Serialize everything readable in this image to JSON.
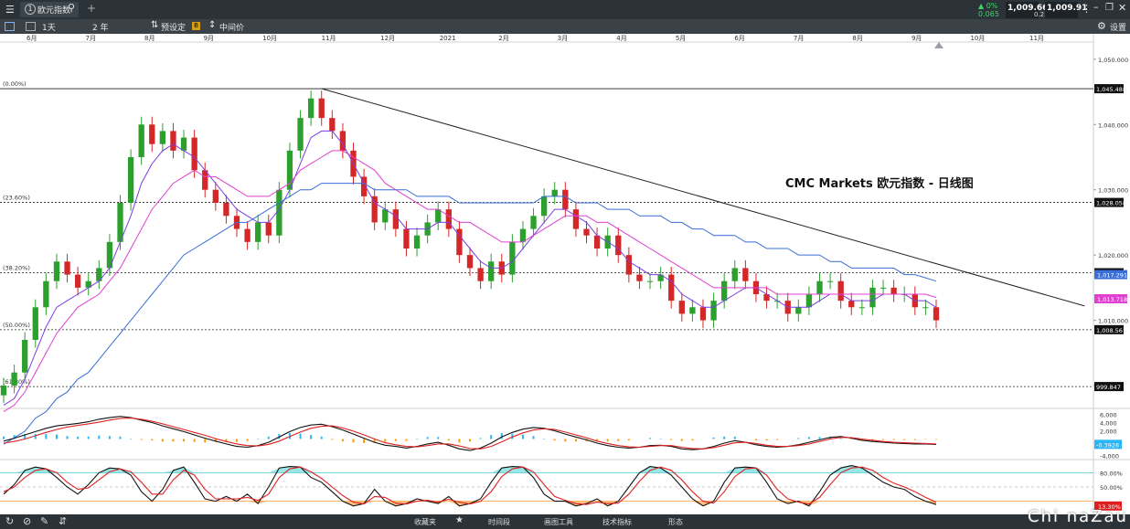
{
  "window": {
    "tab_number": "1",
    "tab_title": "欧元指数",
    "quote_change_pct": "0%",
    "quote_change_abs": "0.065",
    "bid": "1,009.66",
    "ask": "1,009.91",
    "spread": "0.25"
  },
  "toolbar": {
    "period": "1天",
    "range": "2 年",
    "preset": "预设定",
    "price_type": "中间价",
    "settings": "设置"
  },
  "chart_title": "CMC Markets 欧元指数 - 日线图",
  "bottom_bar": {
    "favorites": "收藏夹",
    "timeframe": "时间段",
    "drawing_tools": "画图工具",
    "indicators": "技术指标",
    "patterns": "形态"
  },
  "watermark": "Chi naZau",
  "colors": {
    "bull": "#2ca02c",
    "bear": "#d62728",
    "ma_fast": "#7b3fe4",
    "ma_mid": "#e040d0",
    "ma_slow": "#3a6fd8",
    "macd_pos": "#29b6f6",
    "macd_neg": "#ff9800",
    "stoch_band_high": "#7ee0e0",
    "stoch_band_low": "#ffb060"
  },
  "chart_data": {
    "type": "candlestick",
    "x_ticks": [
      "6月",
      "7月",
      "8月",
      "9月",
      "10月",
      "11月",
      "12月",
      "2021",
      "2月",
      "3月",
      "4月",
      "5月",
      "6月",
      "7月",
      "8月",
      "9月",
      "10月",
      "11月"
    ],
    "y_ticks": [
      "1,050.000",
      "1,040.000",
      "1,030.000",
      "1,020.000",
      "1,010.000",
      "1,000"
    ],
    "ylim": [
      996.5,
      1052.5
    ],
    "closes": [
      1000,
      1002,
      1007,
      1012,
      1016,
      1019,
      1017,
      1015,
      1016,
      1018,
      1022,
      1028,
      1035,
      1040,
      1037,
      1039,
      1036,
      1038,
      1033,
      1030,
      1028,
      1026,
      1024,
      1022,
      1025,
      1023,
      1030,
      1036,
      1041,
      1044,
      1041,
      1039,
      1036,
      1032,
      1029,
      1025,
      1027,
      1024,
      1021,
      1023,
      1025,
      1027,
      1024,
      1020,
      1018,
      1016,
      1019,
      1017,
      1022,
      1024,
      1026,
      1029,
      1030,
      1027,
      1024,
      1023,
      1021,
      1023,
      1020,
      1017,
      1016,
      1016,
      1017,
      1013,
      1011,
      1012,
      1010,
      1013,
      1016,
      1018,
      1016,
      1014,
      1013,
      1013,
      1011,
      1012,
      1014,
      1016,
      1016,
      1013,
      1012,
      1012,
      1015,
      1015,
      1014,
      1014,
      1012,
      1012,
      1010
    ],
    "moving_averages": {
      "fast": [
        997,
        998,
        1001,
        1005,
        1009,
        1012,
        1013,
        1014,
        1015,
        1016,
        1018,
        1022,
        1026,
        1031,
        1034,
        1036,
        1037,
        1036,
        1035,
        1033,
        1031,
        1029,
        1027,
        1026,
        1025,
        1025,
        1027,
        1030,
        1034,
        1038,
        1039,
        1039,
        1037,
        1034,
        1031,
        1028,
        1027,
        1026,
        1024,
        1024,
        1024,
        1025,
        1025,
        1023,
        1021,
        1019,
        1018,
        1018,
        1019,
        1021,
        1023,
        1025,
        1027,
        1027,
        1026,
        1025,
        1023,
        1022,
        1021,
        1019,
        1018,
        1017,
        1017,
        1016,
        1014,
        1013,
        1012,
        1012,
        1013,
        1014,
        1015,
        1015,
        1014,
        1013,
        1012,
        1012,
        1012,
        1013,
        1014,
        1014,
        1013,
        1013,
        1013,
        1014,
        1014,
        1014,
        1013,
        1013,
        1012
      ],
      "mid": [
        996,
        997,
        999,
        1002,
        1005,
        1008,
        1010,
        1012,
        1013,
        1014,
        1016,
        1018,
        1021,
        1024,
        1027,
        1029,
        1031,
        1032,
        1033,
        1032,
        1032,
        1031,
        1030,
        1029,
        1029,
        1029,
        1030,
        1031,
        1033,
        1034,
        1035,
        1036,
        1036,
        1035,
        1034,
        1033,
        1031,
        1030,
        1029,
        1028,
        1027,
        1027,
        1026,
        1025,
        1025,
        1024,
        1023,
        1022,
        1022,
        1022,
        1023,
        1024,
        1025,
        1026,
        1026,
        1026,
        1025,
        1025,
        1024,
        1023,
        1022,
        1021,
        1020,
        1019,
        1018,
        1017,
        1016,
        1015,
        1015,
        1015,
        1015,
        1015,
        1015,
        1014,
        1014,
        1014,
        1014,
        1014,
        1014,
        1014,
        1014,
        1014,
        1014,
        1014,
        1014,
        1014,
        1014,
        1014,
        1013.5
      ],
      "slow": [
        991,
        992,
        993,
        995,
        996,
        998,
        999,
        1001,
        1002,
        1004,
        1006,
        1008,
        1010,
        1012,
        1014,
        1016,
        1018,
        1020,
        1021,
        1022,
        1023,
        1024,
        1025,
        1025,
        1026,
        1027,
        1028,
        1029,
        1030,
        1030,
        1031,
        1031,
        1031,
        1031,
        1031,
        1030,
        1030,
        1030,
        1030,
        1029,
        1029,
        1029,
        1029,
        1028,
        1028,
        1028,
        1028,
        1028,
        1028,
        1028,
        1028,
        1029,
        1029,
        1029,
        1028,
        1028,
        1028,
        1027,
        1027,
        1027,
        1026,
        1026,
        1026,
        1025,
        1025,
        1024,
        1024,
        1023,
        1023,
        1023,
        1022,
        1022,
        1021,
        1021,
        1021,
        1020,
        1020,
        1020,
        1019,
        1019,
        1018,
        1018,
        1018,
        1018,
        1018,
        1017,
        1017,
        1016.5,
        1016
      ]
    },
    "trendline": {
      "start": {
        "index": 30,
        "value": 1045.5
      },
      "end": {
        "index": 102,
        "value": 1012.2
      }
    },
    "fib_levels": [
      {
        "label": "(0.00%)",
        "value": 1045.488,
        "tag": "1,045.488"
      },
      {
        "label": "(23.60%)",
        "value": 1028.058,
        "tag": "1,028.058"
      },
      {
        "label": "(38.20%)",
        "value": 1017.291,
        "tag": "1,017.291"
      },
      {
        "label": "(50.00%)",
        "value": 1008.561,
        "tag": "1,008.561"
      },
      {
        "label": "(61.80%)",
        "value": 999.847,
        "tag": "999.847"
      }
    ],
    "ma_tags": [
      {
        "value": 1017.0,
        "text": "1,017.291",
        "color": "#3a6fd8"
      },
      {
        "value": 1013.3,
        "text": "1,013.718",
        "color": "#e040d0"
      }
    ],
    "macd": {
      "y_ticks": [
        "6,000",
        "4,000",
        "2,000",
        "-4,000"
      ],
      "ylim": [
        -5,
        7
      ],
      "value_tag": "-0.3926",
      "macd_line": [
        -0.5,
        0.2,
        1.0,
        1.8,
        2.6,
        3.2,
        3.5,
        3.8,
        4.2,
        4.8,
        5.2,
        5.5,
        5.2,
        4.6,
        4.0,
        3.2,
        2.5,
        1.8,
        1.0,
        0.2,
        -0.5,
        -1.2,
        -1.8,
        -2.0,
        -1.6,
        -0.8,
        0.5,
        1.8,
        2.8,
        3.4,
        3.6,
        3.0,
        2.2,
        1.2,
        0.2,
        -0.8,
        -1.5,
        -1.8,
        -2.2,
        -1.8,
        -1.2,
        -0.8,
        -1.5,
        -2.4,
        -2.8,
        -2.2,
        -1.0,
        0.5,
        1.6,
        2.4,
        2.8,
        2.6,
        2.0,
        1.2,
        0.5,
        -0.2,
        -1.0,
        -1.6,
        -2.0,
        -2.2,
        -2.0,
        -1.6,
        -1.5,
        -1.8,
        -2.4,
        -2.6,
        -2.4,
        -1.8,
        -1.0,
        -0.4,
        -0.8,
        -1.4,
        -1.8,
        -2.0,
        -1.8,
        -1.4,
        -0.8,
        -0.2,
        0.4,
        0.6,
        0.2,
        -0.3,
        -0.6,
        -0.8,
        -1.0,
        -1.1,
        -1.2,
        -1.2,
        -1.3
      ],
      "signal_line": [
        -1.0,
        -0.6,
        0.0,
        0.8,
        1.6,
        2.3,
        2.9,
        3.3,
        3.7,
        4.1,
        4.6,
        5.0,
        5.1,
        4.8,
        4.3,
        3.7,
        3.0,
        2.3,
        1.6,
        0.9,
        0.1,
        -0.6,
        -1.2,
        -1.6,
        -1.7,
        -1.3,
        -0.5,
        0.6,
        1.7,
        2.6,
        3.1,
        3.2,
        2.7,
        1.9,
        1.0,
        0.0,
        -0.9,
        -1.4,
        -1.8,
        -1.9,
        -1.6,
        -1.2,
        -1.2,
        -1.7,
        -2.3,
        -2.4,
        -1.8,
        -0.7,
        0.5,
        1.5,
        2.2,
        2.5,
        2.3,
        1.7,
        1.0,
        0.3,
        -0.5,
        -1.1,
        -1.6,
        -1.9,
        -2.0,
        -1.8,
        -1.6,
        -1.6,
        -2.0,
        -2.3,
        -2.4,
        -2.1,
        -1.5,
        -0.9,
        -0.8,
        -1.1,
        -1.5,
        -1.8,
        -1.8,
        -1.6,
        -1.2,
        -0.6,
        0.0,
        0.4,
        0.3,
        0.0,
        -0.3,
        -0.6,
        -0.8,
        -0.9,
        -1.0,
        -1.1,
        -1.2
      ]
    },
    "stochastic": {
      "y_ticks": [
        "80.00%",
        "50.00%"
      ],
      "ylim": [
        0,
        100
      ],
      "value_tag": "13.30%",
      "k_line": [
        35,
        55,
        85,
        92,
        88,
        70,
        50,
        35,
        55,
        80,
        90,
        88,
        75,
        40,
        20,
        45,
        85,
        92,
        60,
        25,
        20,
        30,
        20,
        35,
        15,
        50,
        90,
        93,
        92,
        70,
        60,
        40,
        20,
        10,
        15,
        45,
        20,
        10,
        15,
        25,
        20,
        15,
        30,
        10,
        15,
        25,
        60,
        90,
        93,
        92,
        70,
        35,
        20,
        20,
        10,
        15,
        25,
        10,
        20,
        50,
        80,
        93,
        90,
        75,
        50,
        25,
        10,
        20,
        60,
        90,
        92,
        90,
        60,
        25,
        15,
        20,
        10,
        40,
        75,
        90,
        95,
        90,
        75,
        60,
        50,
        45,
        30,
        20,
        13
      ],
      "d_line": [
        40,
        50,
        70,
        85,
        88,
        80,
        60,
        45,
        48,
        65,
        82,
        88,
        82,
        60,
        35,
        35,
        65,
        85,
        75,
        45,
        25,
        25,
        25,
        28,
        22,
        35,
        70,
        88,
        92,
        82,
        68,
        50,
        32,
        18,
        14,
        30,
        28,
        16,
        14,
        20,
        22,
        18,
        24,
        18,
        14,
        20,
        40,
        72,
        88,
        92,
        82,
        55,
        30,
        22,
        15,
        13,
        18,
        15,
        16,
        35,
        62,
        85,
        92,
        85,
        65,
        40,
        20,
        16,
        40,
        72,
        88,
        90,
        75,
        45,
        25,
        18,
        14,
        28,
        55,
        80,
        90,
        92,
        85,
        70,
        58,
        50,
        40,
        28,
        18
      ]
    }
  }
}
